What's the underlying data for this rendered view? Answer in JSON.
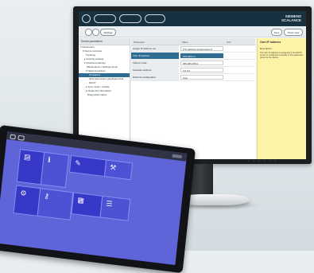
{
  "monitor": {
    "topbar": {
      "buttons": [
        "",
        "",
        ""
      ],
      "brand_line1": "SIEMENS",
      "brand_line2": "SCALANCE"
    },
    "toolbar": {
      "back_label": "",
      "dropdown_label": "Settings",
      "right_btn1": "Save",
      "right_btn2": "Reset view"
    },
    "sidebar": {
      "header": "Device parameters",
      "items": [
        {
          "label": "▾ Parameters",
          "selected": false
        },
        {
          "label": "▾ Device overview",
          "selected": false
        },
        {
          "label": "Topology",
          "selected": false
        },
        {
          "label": "▸ Security settings",
          "selected": false
        },
        {
          "label": "▾ Advanced settings",
          "selected": false
        },
        {
          "label": "Maintenance / Settings group",
          "selected": false
        },
        {
          "label": "▾ Network settings",
          "selected": false
        },
        {
          "label": "IP address",
          "selected": true
        },
        {
          "label": "IPv4 parameters (duplicate) field",
          "selected": false
        },
        {
          "label": "DHCP",
          "selected": false
        },
        {
          "label": "▸ Sync mode / module",
          "selected": false
        },
        {
          "label": "▸ Diagnostic information",
          "selected": false
        },
        {
          "label": "Diagnostics status",
          "selected": false
        }
      ]
    },
    "grid": {
      "headers": [
        "Parameter",
        "Value",
        "Unit"
      ],
      "rows": [
        {
          "label": "Assign IP address via",
          "value": "▾ IP address (parameters) ▾",
          "selected": false
        },
        {
          "label": "Own IP address",
          "value": "192.168.0.1",
          "selected": true
        },
        {
          "label": "Subnet mask",
          "value": "255.255.255.0",
          "selected": false
        },
        {
          "label": "Gateway address",
          "value": "0.0.0.0",
          "selected": false
        },
        {
          "label": "Ethernet configuration",
          "value": "Auto",
          "selected": false
        }
      ]
    },
    "help": {
      "title": "Own IP address",
      "subtitle": "Description",
      "text": "The own IP address is assigned by the DHCP server or configured manually in this parameter group for the device."
    },
    "status": "○ ○ ○ ○ ○ ○"
  },
  "tablet": {
    "tiles": [
      {
        "icon": "device-icon",
        "glyph": "▤"
      },
      {
        "icon": "info-icon",
        "glyph": "ℹ"
      },
      {
        "icon": "wrench-icon",
        "glyph": "✎"
      },
      {
        "icon": "tools-icon",
        "glyph": "⚒"
      },
      {
        "icon": "settings-icon",
        "glyph": "⚙"
      },
      {
        "icon": "key-icon",
        "glyph": "⚷"
      },
      {
        "icon": "chart-icon",
        "glyph": "▦"
      },
      {
        "icon": "list-icon",
        "glyph": "☰"
      }
    ]
  },
  "colors": {
    "tablet_bg": "#5f64d8",
    "tile": "#3737c8",
    "help_bg": "#fdf3a6",
    "selected": "#2e6c91",
    "topbar": "#16313f"
  }
}
